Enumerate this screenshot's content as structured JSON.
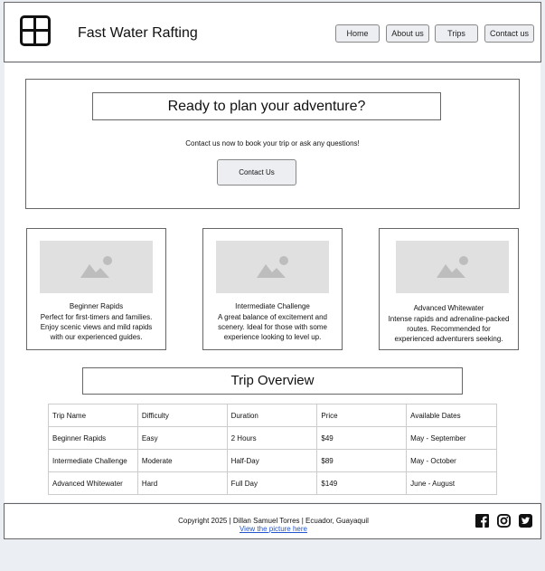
{
  "header": {
    "brand": "Fast Water Rafting",
    "nav": [
      "Home",
      "About us",
      "Trips",
      "Contact us"
    ]
  },
  "hero": {
    "title": "Ready to plan your adventure?",
    "text": "Contact us now to book your trip or ask any questions!",
    "button": "Contact Us"
  },
  "cards": [
    {
      "title": "Beginner Rapids",
      "desc": "Perfect for first-timers and families. Enjoy scenic views and mild rapids with our experienced guides."
    },
    {
      "title": "Intermediate Challenge",
      "desc": "A great balance of excitement and scenery. Ideal for those with some experience looking to level up."
    },
    {
      "title": "Advanced Whitewater",
      "desc": "Intense rapids and adrenaline-packed routes. Recommended for experienced adventurers seeking."
    }
  ],
  "overview": {
    "title": "Trip Overview",
    "columns": [
      "Trip Name",
      "Difficulty",
      "Duration",
      "Price",
      "Available Dates"
    ],
    "rows": [
      [
        "Beginner Rapids",
        "Easy",
        "2 Hours",
        "$49",
        "May - September"
      ],
      [
        "Intermediate Challenge",
        "Moderate",
        "Half-Day",
        "$89",
        "May - October"
      ],
      [
        "Advanced Whitewater",
        "Hard",
        "Full Day",
        "$149",
        "June - August"
      ]
    ]
  },
  "footer": {
    "copyright": "Copyright 2025 | Dillan Samuel Torres | Ecuador, Guayaquil",
    "link": "View the picture here",
    "social": [
      "facebook-icon",
      "instagram-icon",
      "twitter-icon"
    ]
  }
}
